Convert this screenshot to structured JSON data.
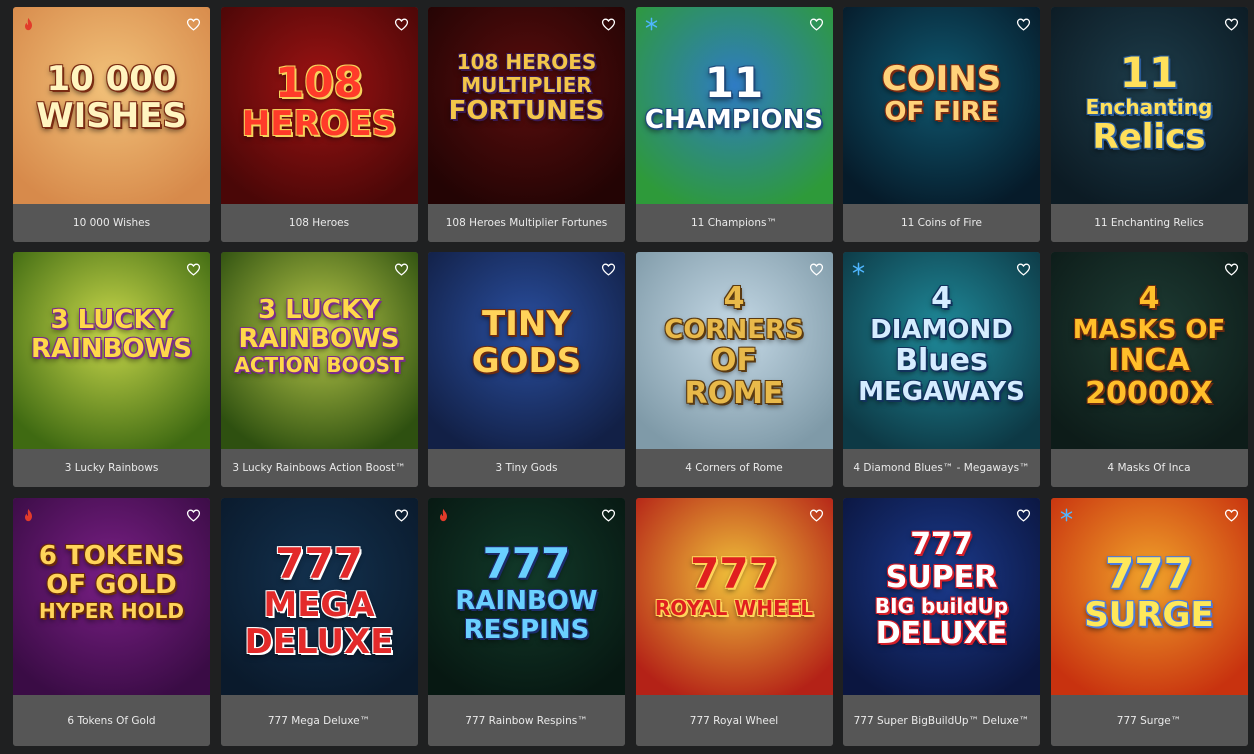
{
  "games": [
    {
      "name": "10 000 Wishes",
      "badge": "hot",
      "art": [
        "10 000",
        "WISHES"
      ],
      "bg": [
        "#f2c27a",
        "#d78a4b"
      ],
      "fg": "#fff5c0",
      "stroke": "#7a2b12"
    },
    {
      "name": "108 Heroes",
      "badge": "",
      "art": [
        "108",
        "HEROES"
      ],
      "bg": [
        "#9d1313",
        "#4a0707"
      ],
      "fg": "#ff3b2a",
      "stroke": "#f6d35b"
    },
    {
      "name": "108 Heroes Multiplier Fortunes",
      "badge": "",
      "art": [
        "108 HEROES",
        "MULTIPLIER",
        "FORTUNES"
      ],
      "bg": [
        "#5a0d0d",
        "#230404"
      ],
      "fg": "#f3c64a",
      "stroke": "#3b1a55"
    },
    {
      "name": "11 Champions™",
      "badge": "snow",
      "art": [
        "11",
        "CHAMPIONS"
      ],
      "bg": [
        "#2f7bc4",
        "#2e9a3a"
      ],
      "fg": "#ffffff",
      "stroke": "#1f4b7c"
    },
    {
      "name": "11 Coins of Fire",
      "badge": "",
      "art": [
        "COINS",
        "OF FIRE"
      ],
      "bg": [
        "#0f5870",
        "#061b2a"
      ],
      "fg": "#ffd27a",
      "stroke": "#7a2b12"
    },
    {
      "name": "11 Enchanting Relics",
      "badge": "",
      "art": [
        "11",
        "Enchanting",
        "Relics"
      ],
      "bg": [
        "#1d3c4a",
        "#0c1b24"
      ],
      "fg": "#ffe05b",
      "stroke": "#2a5b9a"
    },
    {
      "name": "3 Lucky Rainbows",
      "badge": "",
      "art": [
        "3 LUCKY",
        "RAINBOWS"
      ],
      "bg": [
        "#c9d84b",
        "#3f6a12"
      ],
      "fg": "#ffd94a",
      "stroke": "#7a2c8c"
    },
    {
      "name": "3 Lucky Rainbows Action Boost™",
      "badge": "",
      "art": [
        "3 LUCKY",
        "RAINBOWS",
        "ACTION BOOST"
      ],
      "bg": [
        "#b9c94a",
        "#2e5010"
      ],
      "fg": "#ffd94a",
      "stroke": "#7a2c8c"
    },
    {
      "name": "3 Tiny Gods",
      "badge": "",
      "art": [
        "TINY",
        "GODS"
      ],
      "bg": [
        "#2a4fa0",
        "#122046"
      ],
      "fg": "#ffd25a",
      "stroke": "#6b2a10"
    },
    {
      "name": "4 Corners of Rome",
      "badge": "",
      "art": [
        "4",
        "CORNERS",
        "OF",
        "ROME"
      ],
      "bg": [
        "#c5d9e6",
        "#7f9aa8"
      ],
      "fg": "#e8b94a",
      "stroke": "#5a3a12"
    },
    {
      "name": "4 Diamond Blues™ - Megaways™",
      "badge": "snow",
      "art": [
        "4",
        "DIAMOND",
        "Blues",
        "MEGAWAYS"
      ],
      "bg": [
        "#1f8a9a",
        "#0d3945"
      ],
      "fg": "#d5ecff",
      "stroke": "#11325c"
    },
    {
      "name": "4 Masks Of Inca",
      "badge": "",
      "art": [
        "4",
        "MASKS OF",
        "INCA",
        "20000X"
      ],
      "bg": [
        "#1e3c34",
        "#0d1c19"
      ],
      "fg": "#ffbf2a",
      "stroke": "#6b2b10"
    },
    {
      "name": "6 Tokens Of Gold",
      "badge": "hot",
      "art": [
        "6 TOKENS",
        "OF GOLD",
        "HYPER HOLD"
      ],
      "bg": [
        "#7a1f86",
        "#3a0c45"
      ],
      "fg": "#ffd45a",
      "stroke": "#6a2a0a"
    },
    {
      "name": "777 Mega Deluxe™",
      "badge": "",
      "art": [
        "777",
        "MEGA",
        "DELUXE"
      ],
      "bg": [
        "#13314e",
        "#0a1a2c"
      ],
      "fg": "#e32a2a",
      "stroke": "#ffffff"
    },
    {
      "name": "777 Rainbow Respins™",
      "badge": "hot",
      "art": [
        "777",
        "RAINBOW",
        "RESPINS"
      ],
      "bg": [
        "#123a2a",
        "#071812"
      ],
      "fg": "#6ad0ff",
      "stroke": "#1b2b6a"
    },
    {
      "name": "777 Royal Wheel",
      "badge": "",
      "art": [
        "777",
        "ROYAL WHEEL"
      ],
      "bg": [
        "#f0c13a",
        "#b42217"
      ],
      "fg": "#e01f1f",
      "stroke": "#ffd45a"
    },
    {
      "name": "777 Super BigBuildUp™ Deluxe™",
      "badge": "",
      "art": [
        "777",
        "SUPER",
        "BIG buildUp",
        "DELUXE"
      ],
      "bg": [
        "#1b3a8c",
        "#0b1640"
      ],
      "fg": "#ffffff",
      "stroke": "#d41f2a"
    },
    {
      "name": "777 Surge™",
      "badge": "snow",
      "art": [
        "777",
        "SURGE"
      ],
      "bg": [
        "#f0a22a",
        "#c8320f"
      ],
      "fg": "#ffe85a",
      "stroke": "#4a7be0"
    }
  ]
}
